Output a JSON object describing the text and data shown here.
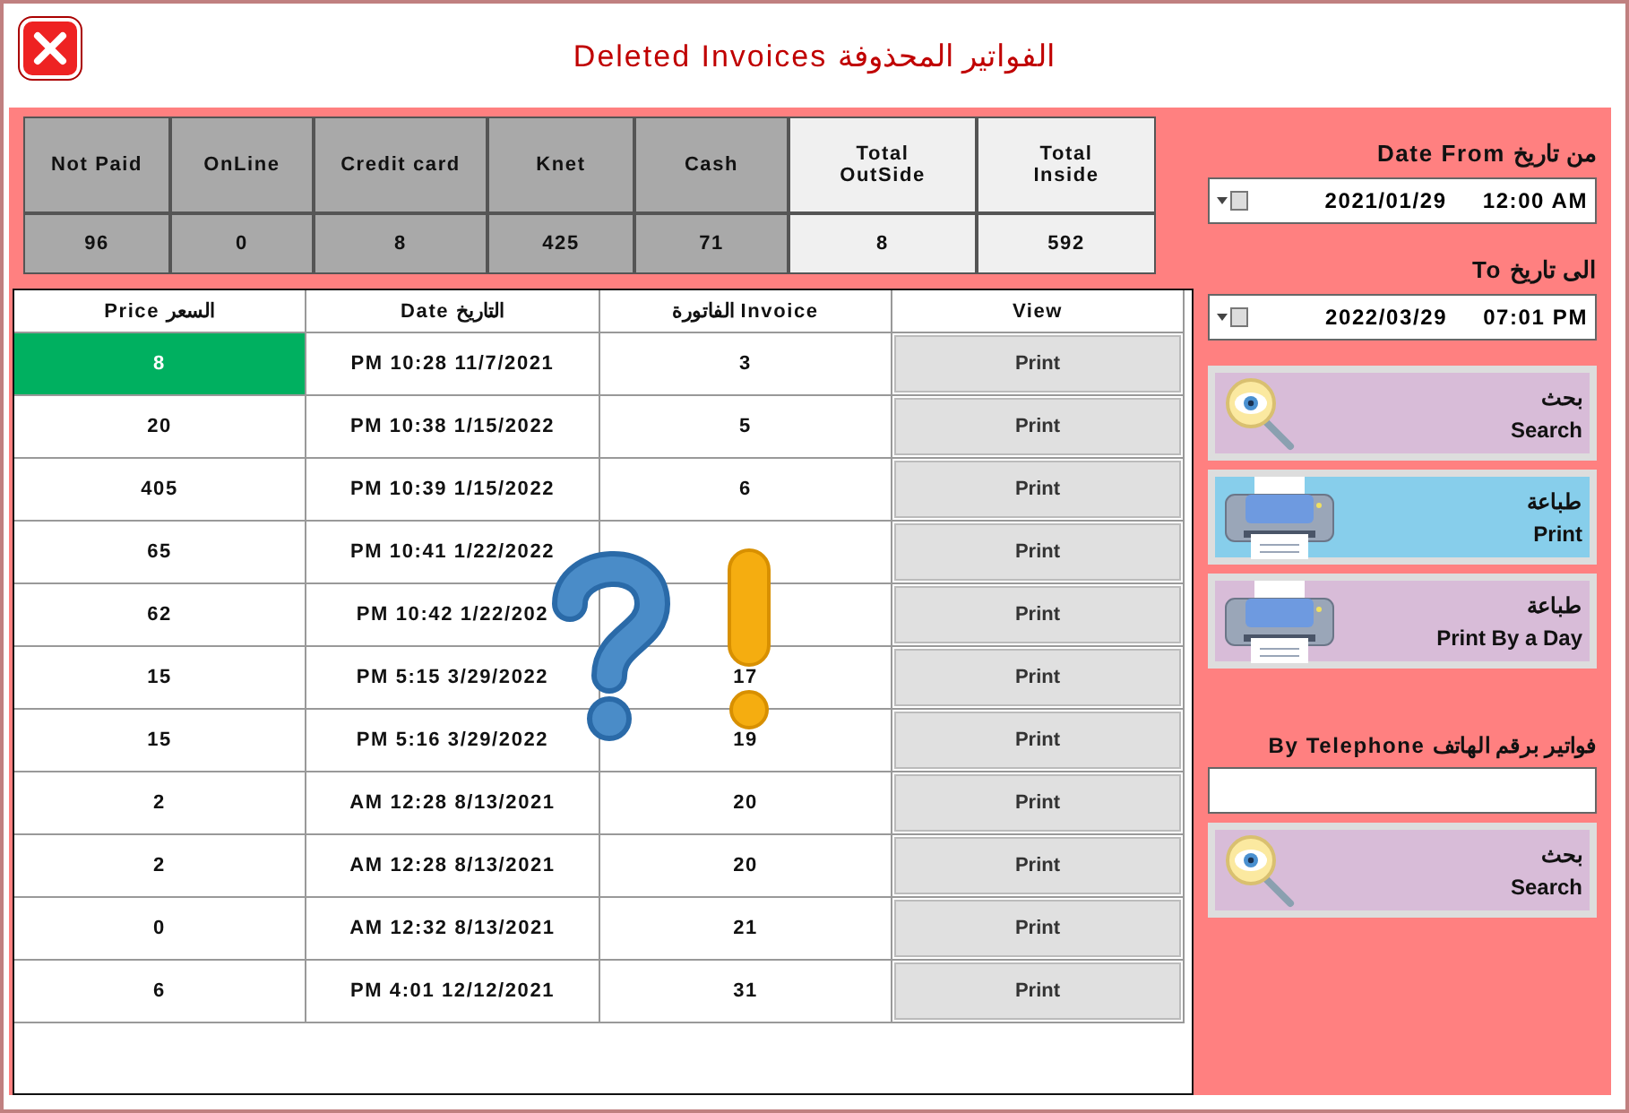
{
  "window": {
    "title": "Deleted Invoices الفواتير المحذوفة"
  },
  "summary": {
    "columns": [
      "Not Paid",
      "OnLine",
      "Credit card",
      "Knet",
      "Cash",
      "Total OutSide",
      "Total Inside"
    ],
    "shaded": [
      true,
      true,
      true,
      true,
      true,
      false,
      false
    ],
    "values": [
      "96",
      "0",
      "8",
      "425",
      "71",
      "8",
      "592"
    ]
  },
  "table": {
    "columns": [
      "Price السعر",
      "Date التاريخ",
      "الفاتورة Invoice",
      "View"
    ],
    "rows": [
      {
        "price": "8",
        "date": "PM 10:28 11/7/2021",
        "invoice": "3",
        "action": "Print",
        "selected": true
      },
      {
        "price": "20",
        "date": "PM 10:38 1/15/2022",
        "invoice": "5",
        "action": "Print",
        "selected": false
      },
      {
        "price": "405",
        "date": "PM 10:39 1/15/2022",
        "invoice": "6",
        "action": "Print",
        "selected": false
      },
      {
        "price": "65",
        "date": "PM 10:41 1/22/2022",
        "action": "Print",
        "selected": false
      },
      {
        "price": "62",
        "date": "PM 10:42 1/22/202",
        "action": "Print",
        "selected": false
      },
      {
        "price": "15",
        "date": "PM 5:15 3/29/2022",
        "invoice": "17",
        "action": "Print",
        "selected": false
      },
      {
        "price": "15",
        "date": "PM 5:16 3/29/2022",
        "invoice": "19",
        "action": "Print",
        "selected": false
      },
      {
        "price": "2",
        "date": "AM 12:28 8/13/2021",
        "invoice": "20",
        "action": "Print",
        "selected": false
      },
      {
        "price": "2",
        "date": "AM 12:28 8/13/2021",
        "invoice": "20",
        "action": "Print",
        "selected": false
      },
      {
        "price": "0",
        "date": "AM 12:32 8/13/2021",
        "invoice": "21",
        "action": "Print",
        "selected": false
      },
      {
        "price": "6",
        "date": "PM 4:01 12/12/2021",
        "invoice": "31",
        "action": "Print",
        "selected": false
      }
    ]
  },
  "filters": {
    "from_label": "Date From من تاريخ",
    "from_date": "2021/01/29",
    "from_time": "12:00 AM",
    "to_label": "To الى تاريخ",
    "to_date": "2022/03/29",
    "to_time": "07:01 PM",
    "buttons": [
      {
        "kind": "search",
        "arabic": "بحث",
        "label": "Search",
        "highlighted": false
      },
      {
        "kind": "print",
        "arabic": "طباعة",
        "label": "Print",
        "highlighted": true
      },
      {
        "kind": "print",
        "arabic": "طباعة",
        "label": "Print By a Day",
        "highlighted": false
      }
    ],
    "telephone_label": "By Telephone فواتير برقم الهاتف",
    "telephone_buttons": [
      {
        "kind": "search",
        "arabic": "بحث",
        "label": "Search",
        "highlighted": false
      }
    ]
  }
}
